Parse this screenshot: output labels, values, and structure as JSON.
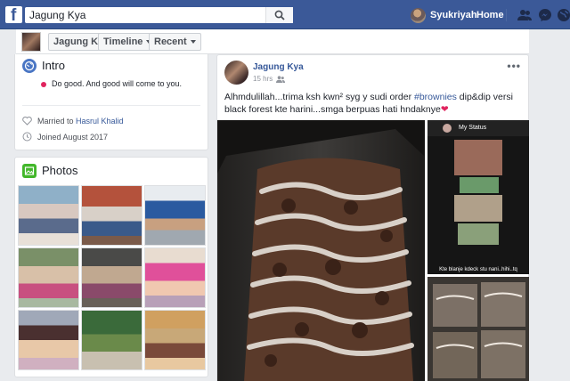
{
  "topbar": {
    "logo": "f",
    "search_value": "Jagung Kya",
    "search_icon": "search-icon",
    "user_name": "Syukriyah",
    "home_label": "Home",
    "icons": [
      "friend-requests-icon",
      "messenger-icon",
      "globe-notifications-icon"
    ]
  },
  "cover_nav": {
    "page_name": "Jagung Kya",
    "timeline_label": "Timeline",
    "recent_label": "Recent"
  },
  "intro": {
    "title": "Intro",
    "bio": "Do good. And good will come to you.",
    "married_prefix": "Married to ",
    "married_to": "Hasrul Khalid",
    "joined": "Joined August 2017"
  },
  "photos": {
    "title": "Photos"
  },
  "post": {
    "author": "Jagung Kya",
    "time": "15 hrs",
    "menu": "•••",
    "text_before": "Alhmdulillah...trima ksh kwn² syg y sudi order ",
    "hashtag": "#brownies",
    "text_after": " dip&dip versi black forest kte harini...smga berpuas hati hndaknye",
    "image_status_label": "My Status",
    "image_caption": "Kte blanje kdeck stu nani..hihi..tq"
  },
  "colors": {
    "fb_blue": "#3b5998",
    "link": "#365899",
    "background": "#e9ebee"
  }
}
